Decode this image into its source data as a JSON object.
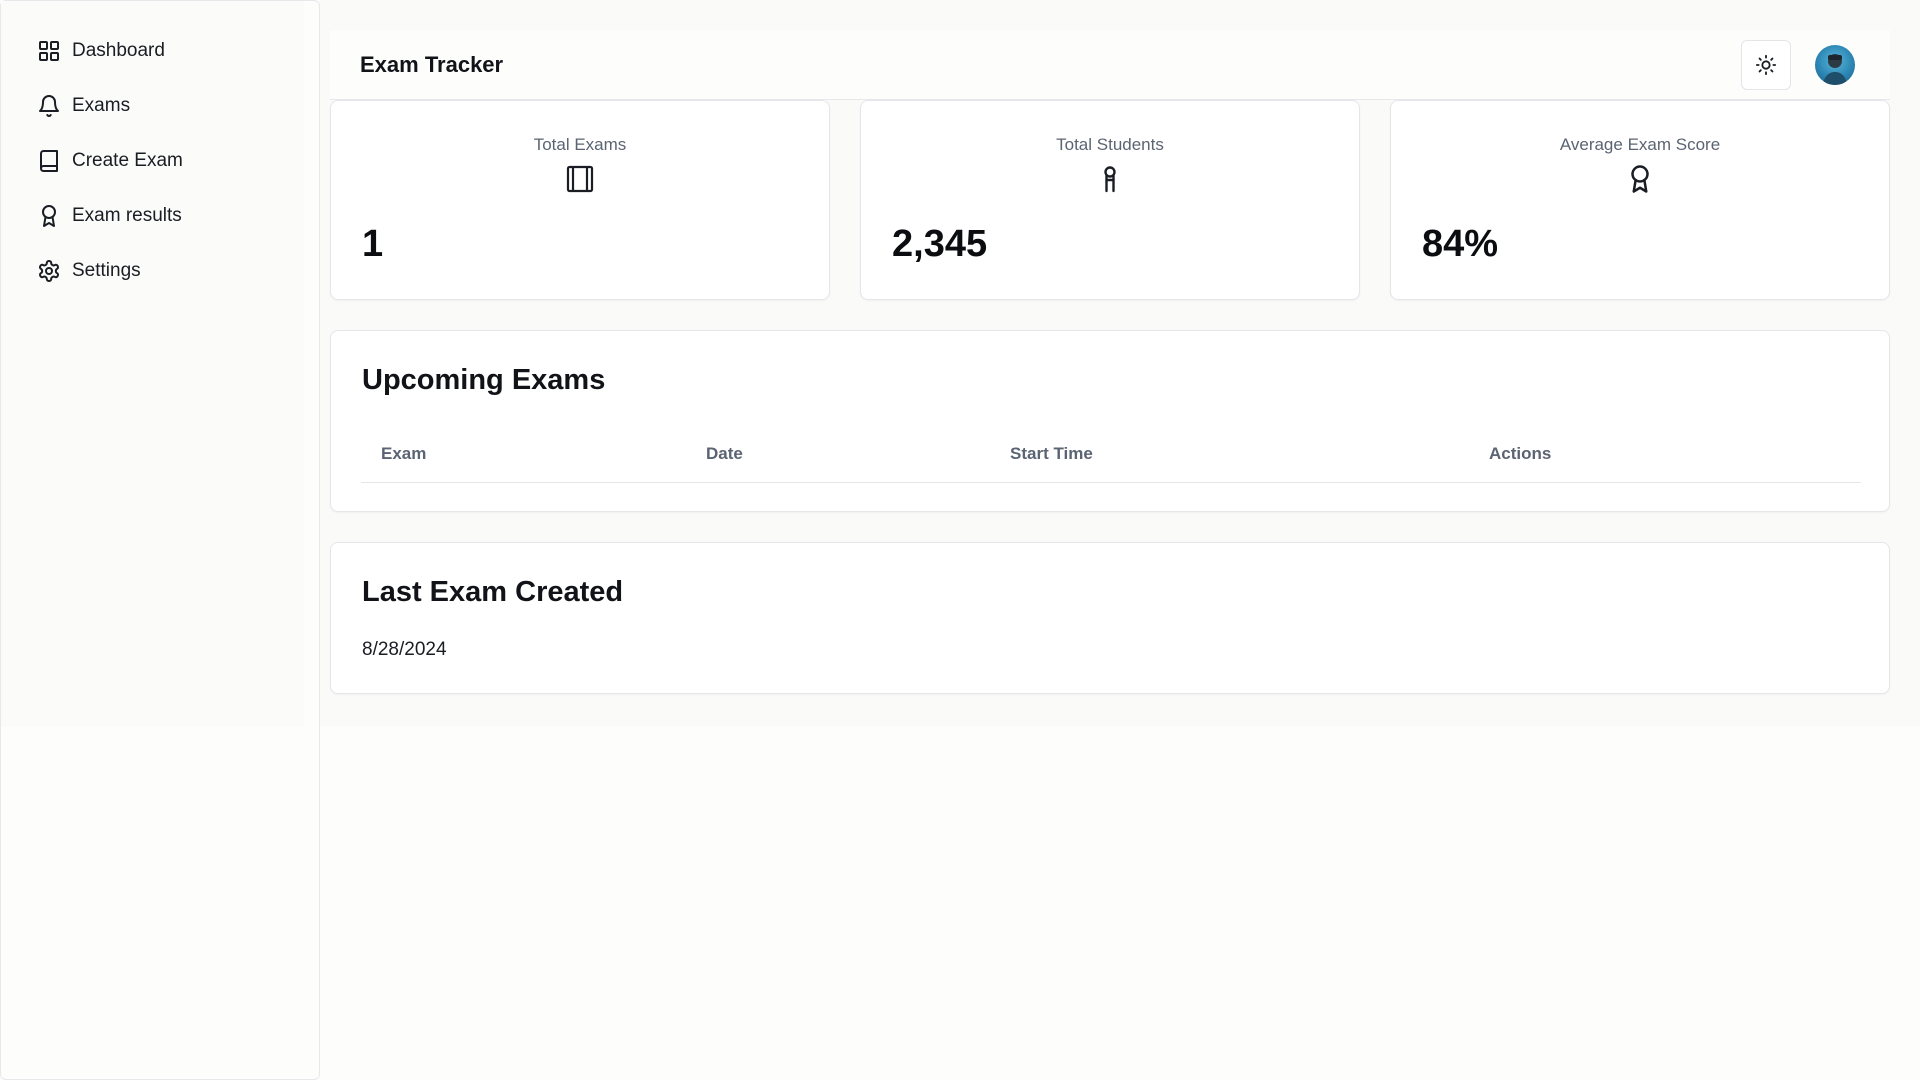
{
  "sidebar": {
    "items": [
      {
        "label": "Dashboard",
        "icon": "dashboard-grid-icon"
      },
      {
        "label": "Exams",
        "icon": "bell-icon"
      },
      {
        "label": "Create Exam",
        "icon": "book-icon"
      },
      {
        "label": "Exam results",
        "icon": "award-icon"
      },
      {
        "label": "Settings",
        "icon": "gear-icon"
      }
    ]
  },
  "header": {
    "title": "Exam Tracker",
    "theme_icon": "sun-icon",
    "avatar": "user-avatar"
  },
  "stats": [
    {
      "label": "Total Exams",
      "icon": "notebook-icon",
      "value": "1"
    },
    {
      "label": "Total Students",
      "icon": "student-ribbon-icon",
      "value": "2,345"
    },
    {
      "label": "Average Exam Score",
      "icon": "award-icon",
      "value": "84%"
    }
  ],
  "upcoming": {
    "title": "Upcoming Exams",
    "columns": [
      "Exam",
      "Date",
      "Start Time",
      "Actions"
    ],
    "rows": []
  },
  "last_exam": {
    "title": "Last Exam Created",
    "date": "8/28/2024"
  }
}
